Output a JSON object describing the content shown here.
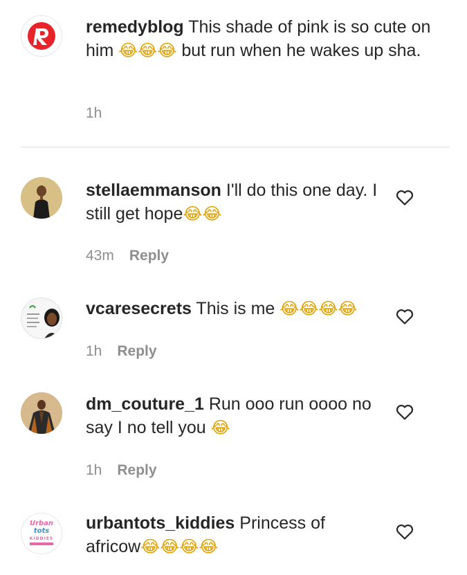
{
  "comments": [
    {
      "username": "remedyblog",
      "text": "This shade of pink is so cute on him",
      "emoji_1": "😂😂😂",
      "text_2": "but run when he wakes up sha.",
      "time": "1h",
      "reply": "",
      "avatar": "remedy-logo"
    },
    {
      "username": "stellaemmanson",
      "text": "I'll do this one day. I still get hope",
      "emoji_1": "😂😂",
      "time": "43m",
      "reply": "Reply",
      "avatar": "profile-photo"
    },
    {
      "username": "vcaresecrets",
      "text": "This is me",
      "emoji_1": "😂😂😂😂",
      "time": "1h",
      "reply": "Reply",
      "avatar": "profile-photo"
    },
    {
      "username": "dm_couture_1",
      "text": "Run ooo run oooo no say I no tell you",
      "emoji_1": "😂",
      "time": "1h",
      "reply": "Reply",
      "avatar": "profile-photo"
    },
    {
      "username": "urbantots_kiddies",
      "text": "Princess of africow",
      "emoji_1": "😂😂😂😂",
      "time": "",
      "reply": "",
      "avatar": "urbantots-logo"
    }
  ],
  "urbantots_logo": {
    "line1": "Urban",
    "line2": "tots",
    "line3": "KIDDIES"
  },
  "colors": {
    "remedy_red": "#e8242b",
    "meta_gray": "#8e8e8e",
    "text": "#262626",
    "divider": "#dbdbdb"
  }
}
